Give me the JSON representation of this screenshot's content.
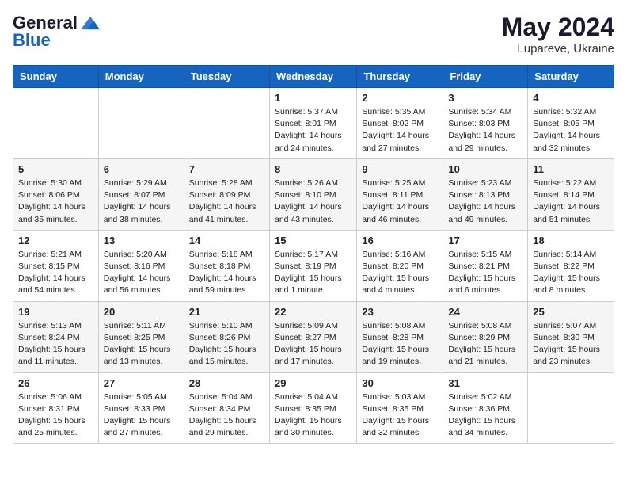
{
  "header": {
    "logo_general": "General",
    "logo_blue": "Blue",
    "month_year": "May 2024",
    "location": "Lupareve, Ukraine"
  },
  "weekdays": [
    "Sunday",
    "Monday",
    "Tuesday",
    "Wednesday",
    "Thursday",
    "Friday",
    "Saturday"
  ],
  "weeks": [
    [
      {
        "day": "",
        "text": ""
      },
      {
        "day": "",
        "text": ""
      },
      {
        "day": "",
        "text": ""
      },
      {
        "day": "1",
        "text": "Sunrise: 5:37 AM\nSunset: 8:01 PM\nDaylight: 14 hours\nand 24 minutes."
      },
      {
        "day": "2",
        "text": "Sunrise: 5:35 AM\nSunset: 8:02 PM\nDaylight: 14 hours\nand 27 minutes."
      },
      {
        "day": "3",
        "text": "Sunrise: 5:34 AM\nSunset: 8:03 PM\nDaylight: 14 hours\nand 29 minutes."
      },
      {
        "day": "4",
        "text": "Sunrise: 5:32 AM\nSunset: 8:05 PM\nDaylight: 14 hours\nand 32 minutes."
      }
    ],
    [
      {
        "day": "5",
        "text": "Sunrise: 5:30 AM\nSunset: 8:06 PM\nDaylight: 14 hours\nand 35 minutes."
      },
      {
        "day": "6",
        "text": "Sunrise: 5:29 AM\nSunset: 8:07 PM\nDaylight: 14 hours\nand 38 minutes."
      },
      {
        "day": "7",
        "text": "Sunrise: 5:28 AM\nSunset: 8:09 PM\nDaylight: 14 hours\nand 41 minutes."
      },
      {
        "day": "8",
        "text": "Sunrise: 5:26 AM\nSunset: 8:10 PM\nDaylight: 14 hours\nand 43 minutes."
      },
      {
        "day": "9",
        "text": "Sunrise: 5:25 AM\nSunset: 8:11 PM\nDaylight: 14 hours\nand 46 minutes."
      },
      {
        "day": "10",
        "text": "Sunrise: 5:23 AM\nSunset: 8:13 PM\nDaylight: 14 hours\nand 49 minutes."
      },
      {
        "day": "11",
        "text": "Sunrise: 5:22 AM\nSunset: 8:14 PM\nDaylight: 14 hours\nand 51 minutes."
      }
    ],
    [
      {
        "day": "12",
        "text": "Sunrise: 5:21 AM\nSunset: 8:15 PM\nDaylight: 14 hours\nand 54 minutes."
      },
      {
        "day": "13",
        "text": "Sunrise: 5:20 AM\nSunset: 8:16 PM\nDaylight: 14 hours\nand 56 minutes."
      },
      {
        "day": "14",
        "text": "Sunrise: 5:18 AM\nSunset: 8:18 PM\nDaylight: 14 hours\nand 59 minutes."
      },
      {
        "day": "15",
        "text": "Sunrise: 5:17 AM\nSunset: 8:19 PM\nDaylight: 15 hours\nand 1 minute."
      },
      {
        "day": "16",
        "text": "Sunrise: 5:16 AM\nSunset: 8:20 PM\nDaylight: 15 hours\nand 4 minutes."
      },
      {
        "day": "17",
        "text": "Sunrise: 5:15 AM\nSunset: 8:21 PM\nDaylight: 15 hours\nand 6 minutes."
      },
      {
        "day": "18",
        "text": "Sunrise: 5:14 AM\nSunset: 8:22 PM\nDaylight: 15 hours\nand 8 minutes."
      }
    ],
    [
      {
        "day": "19",
        "text": "Sunrise: 5:13 AM\nSunset: 8:24 PM\nDaylight: 15 hours\nand 11 minutes."
      },
      {
        "day": "20",
        "text": "Sunrise: 5:11 AM\nSunset: 8:25 PM\nDaylight: 15 hours\nand 13 minutes."
      },
      {
        "day": "21",
        "text": "Sunrise: 5:10 AM\nSunset: 8:26 PM\nDaylight: 15 hours\nand 15 minutes."
      },
      {
        "day": "22",
        "text": "Sunrise: 5:09 AM\nSunset: 8:27 PM\nDaylight: 15 hours\nand 17 minutes."
      },
      {
        "day": "23",
        "text": "Sunrise: 5:08 AM\nSunset: 8:28 PM\nDaylight: 15 hours\nand 19 minutes."
      },
      {
        "day": "24",
        "text": "Sunrise: 5:08 AM\nSunset: 8:29 PM\nDaylight: 15 hours\nand 21 minutes."
      },
      {
        "day": "25",
        "text": "Sunrise: 5:07 AM\nSunset: 8:30 PM\nDaylight: 15 hours\nand 23 minutes."
      }
    ],
    [
      {
        "day": "26",
        "text": "Sunrise: 5:06 AM\nSunset: 8:31 PM\nDaylight: 15 hours\nand 25 minutes."
      },
      {
        "day": "27",
        "text": "Sunrise: 5:05 AM\nSunset: 8:33 PM\nDaylight: 15 hours\nand 27 minutes."
      },
      {
        "day": "28",
        "text": "Sunrise: 5:04 AM\nSunset: 8:34 PM\nDaylight: 15 hours\nand 29 minutes."
      },
      {
        "day": "29",
        "text": "Sunrise: 5:04 AM\nSunset: 8:35 PM\nDaylight: 15 hours\nand 30 minutes."
      },
      {
        "day": "30",
        "text": "Sunrise: 5:03 AM\nSunset: 8:35 PM\nDaylight: 15 hours\nand 32 minutes."
      },
      {
        "day": "31",
        "text": "Sunrise: 5:02 AM\nSunset: 8:36 PM\nDaylight: 15 hours\nand 34 minutes."
      },
      {
        "day": "",
        "text": ""
      }
    ]
  ]
}
